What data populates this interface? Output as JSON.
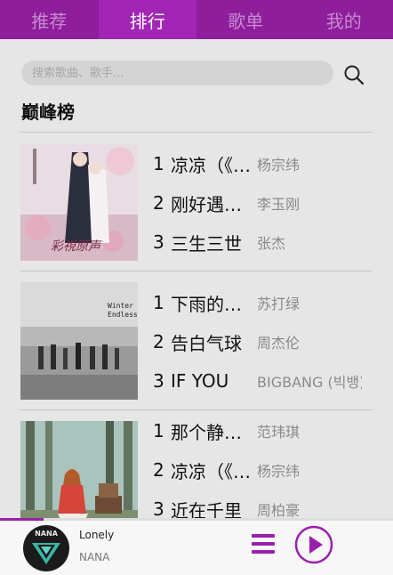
{
  "tabs": [
    {
      "label": "推荐",
      "active": false
    },
    {
      "label": "排行",
      "active": true
    },
    {
      "label": "歌单",
      "active": false
    },
    {
      "label": "我的",
      "active": false
    }
  ],
  "search": {
    "placeholder": "搜索歌曲、歌手...",
    "icon": "search-icon"
  },
  "section_title": "巅峰榜",
  "charts": [
    {
      "cover_icon": "ancient-drama-poster",
      "songs": [
        {
          "rank": "1",
          "title": "凉凉（《三生三世十里桃花》片尾曲）",
          "artist": "杨宗纬"
        },
        {
          "rank": "2",
          "title": "刚好遇见你",
          "artist": "李玉刚"
        },
        {
          "rank": "3",
          "title": "三生三世",
          "artist": "张杰"
        }
      ]
    },
    {
      "cover_icon": "winter-endless-album",
      "cover_text": "Winter Endless",
      "songs": [
        {
          "rank": "1",
          "title": "下雨的夜晚",
          "artist": "苏打绿"
        },
        {
          "rank": "2",
          "title": "告白气球",
          "artist": "周杰伦"
        },
        {
          "rank": "3",
          "title": "IF YOU",
          "artist": "BIGBANG (빅뱅)"
        }
      ]
    },
    {
      "cover_icon": "forest-girl-photo",
      "songs": [
        {
          "rank": "1",
          "title": "那个静默的",
          "artist": "范玮琪"
        },
        {
          "rank": "2",
          "title": "凉凉（《三生三世》）",
          "artist": "杨宗纬"
        },
        {
          "rank": "3",
          "title": "近在千里",
          "artist": "周柏豪"
        }
      ]
    }
  ],
  "player": {
    "title": "Lonely",
    "artist": "NANA",
    "avatar_text": "NANA",
    "progress": 0.11,
    "accent": "#9b1fae"
  }
}
